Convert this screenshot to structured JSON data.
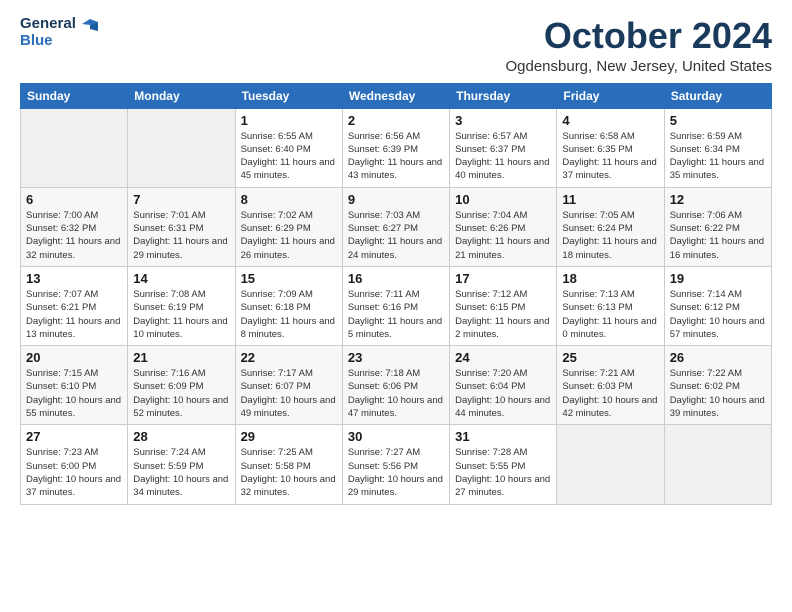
{
  "logo": {
    "line1": "General",
    "line2": "Blue"
  },
  "title": "October 2024",
  "subtitle": "Ogdensburg, New Jersey, United States",
  "weekdays": [
    "Sunday",
    "Monday",
    "Tuesday",
    "Wednesday",
    "Thursday",
    "Friday",
    "Saturday"
  ],
  "weeks": [
    [
      {
        "day": "",
        "detail": ""
      },
      {
        "day": "",
        "detail": ""
      },
      {
        "day": "1",
        "detail": "Sunrise: 6:55 AM\nSunset: 6:40 PM\nDaylight: 11 hours and 45 minutes."
      },
      {
        "day": "2",
        "detail": "Sunrise: 6:56 AM\nSunset: 6:39 PM\nDaylight: 11 hours and 43 minutes."
      },
      {
        "day": "3",
        "detail": "Sunrise: 6:57 AM\nSunset: 6:37 PM\nDaylight: 11 hours and 40 minutes."
      },
      {
        "day": "4",
        "detail": "Sunrise: 6:58 AM\nSunset: 6:35 PM\nDaylight: 11 hours and 37 minutes."
      },
      {
        "day": "5",
        "detail": "Sunrise: 6:59 AM\nSunset: 6:34 PM\nDaylight: 11 hours and 35 minutes."
      }
    ],
    [
      {
        "day": "6",
        "detail": "Sunrise: 7:00 AM\nSunset: 6:32 PM\nDaylight: 11 hours and 32 minutes."
      },
      {
        "day": "7",
        "detail": "Sunrise: 7:01 AM\nSunset: 6:31 PM\nDaylight: 11 hours and 29 minutes."
      },
      {
        "day": "8",
        "detail": "Sunrise: 7:02 AM\nSunset: 6:29 PM\nDaylight: 11 hours and 26 minutes."
      },
      {
        "day": "9",
        "detail": "Sunrise: 7:03 AM\nSunset: 6:27 PM\nDaylight: 11 hours and 24 minutes."
      },
      {
        "day": "10",
        "detail": "Sunrise: 7:04 AM\nSunset: 6:26 PM\nDaylight: 11 hours and 21 minutes."
      },
      {
        "day": "11",
        "detail": "Sunrise: 7:05 AM\nSunset: 6:24 PM\nDaylight: 11 hours and 18 minutes."
      },
      {
        "day": "12",
        "detail": "Sunrise: 7:06 AM\nSunset: 6:22 PM\nDaylight: 11 hours and 16 minutes."
      }
    ],
    [
      {
        "day": "13",
        "detail": "Sunrise: 7:07 AM\nSunset: 6:21 PM\nDaylight: 11 hours and 13 minutes."
      },
      {
        "day": "14",
        "detail": "Sunrise: 7:08 AM\nSunset: 6:19 PM\nDaylight: 11 hours and 10 minutes."
      },
      {
        "day": "15",
        "detail": "Sunrise: 7:09 AM\nSunset: 6:18 PM\nDaylight: 11 hours and 8 minutes."
      },
      {
        "day": "16",
        "detail": "Sunrise: 7:11 AM\nSunset: 6:16 PM\nDaylight: 11 hours and 5 minutes."
      },
      {
        "day": "17",
        "detail": "Sunrise: 7:12 AM\nSunset: 6:15 PM\nDaylight: 11 hours and 2 minutes."
      },
      {
        "day": "18",
        "detail": "Sunrise: 7:13 AM\nSunset: 6:13 PM\nDaylight: 11 hours and 0 minutes."
      },
      {
        "day": "19",
        "detail": "Sunrise: 7:14 AM\nSunset: 6:12 PM\nDaylight: 10 hours and 57 minutes."
      }
    ],
    [
      {
        "day": "20",
        "detail": "Sunrise: 7:15 AM\nSunset: 6:10 PM\nDaylight: 10 hours and 55 minutes."
      },
      {
        "day": "21",
        "detail": "Sunrise: 7:16 AM\nSunset: 6:09 PM\nDaylight: 10 hours and 52 minutes."
      },
      {
        "day": "22",
        "detail": "Sunrise: 7:17 AM\nSunset: 6:07 PM\nDaylight: 10 hours and 49 minutes."
      },
      {
        "day": "23",
        "detail": "Sunrise: 7:18 AM\nSunset: 6:06 PM\nDaylight: 10 hours and 47 minutes."
      },
      {
        "day": "24",
        "detail": "Sunrise: 7:20 AM\nSunset: 6:04 PM\nDaylight: 10 hours and 44 minutes."
      },
      {
        "day": "25",
        "detail": "Sunrise: 7:21 AM\nSunset: 6:03 PM\nDaylight: 10 hours and 42 minutes."
      },
      {
        "day": "26",
        "detail": "Sunrise: 7:22 AM\nSunset: 6:02 PM\nDaylight: 10 hours and 39 minutes."
      }
    ],
    [
      {
        "day": "27",
        "detail": "Sunrise: 7:23 AM\nSunset: 6:00 PM\nDaylight: 10 hours and 37 minutes."
      },
      {
        "day": "28",
        "detail": "Sunrise: 7:24 AM\nSunset: 5:59 PM\nDaylight: 10 hours and 34 minutes."
      },
      {
        "day": "29",
        "detail": "Sunrise: 7:25 AM\nSunset: 5:58 PM\nDaylight: 10 hours and 32 minutes."
      },
      {
        "day": "30",
        "detail": "Sunrise: 7:27 AM\nSunset: 5:56 PM\nDaylight: 10 hours and 29 minutes."
      },
      {
        "day": "31",
        "detail": "Sunrise: 7:28 AM\nSunset: 5:55 PM\nDaylight: 10 hours and 27 minutes."
      },
      {
        "day": "",
        "detail": ""
      },
      {
        "day": "",
        "detail": ""
      }
    ]
  ]
}
